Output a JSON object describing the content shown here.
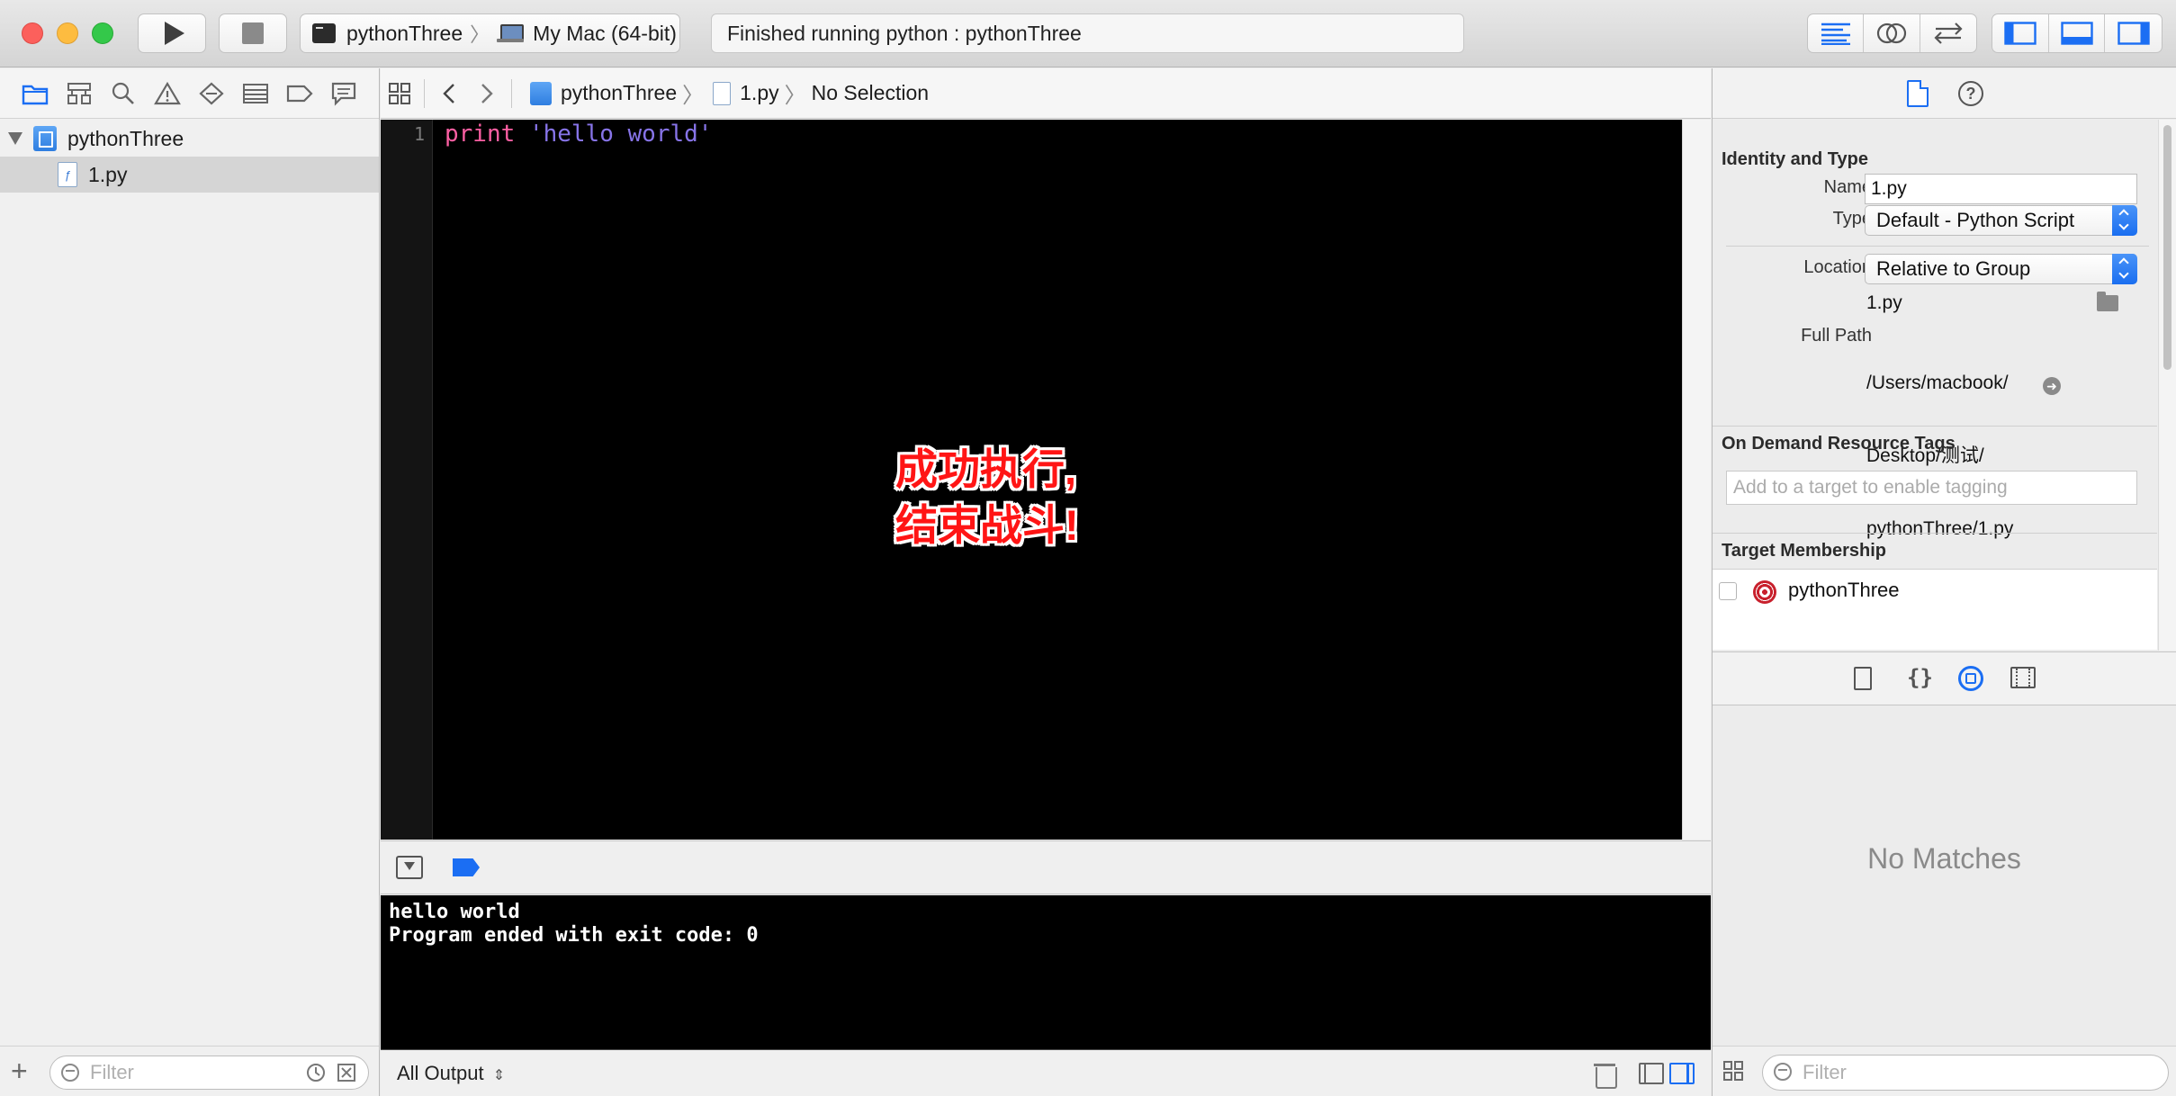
{
  "toolbar": {
    "scheme": {
      "target": "pythonThree",
      "destination": "My Mac (64-bit)"
    },
    "activity_status": "Finished running python : pythonThree"
  },
  "navigator": {
    "project_name": "pythonThree",
    "files": [
      {
        "name": "1.py",
        "selected": true
      }
    ],
    "filter_placeholder": "Filter"
  },
  "editor": {
    "jump_bar": {
      "project": "pythonThree",
      "file": "1.py",
      "selection": "No Selection"
    },
    "line_number": "1",
    "code": {
      "keyword": "print",
      "string": "'hello world'"
    },
    "overlay_line1": "成功执行,",
    "overlay_line2": "结束战斗!"
  },
  "console": {
    "line1": "hello world",
    "line2": "Program ended with exit code: 0",
    "output_filter": "All Output"
  },
  "inspector": {
    "identity_title": "Identity and Type",
    "name_label": "Name",
    "name_value": "1.py",
    "type_label": "Type",
    "type_value": "Default - Python Script",
    "location_label": "Location",
    "location_value": "Relative to Group",
    "file_name": "1.py",
    "full_path_label": "Full Path",
    "full_path_line1": "/Users/macbook/",
    "full_path_line2": "Desktop/测试/",
    "full_path_line3": "pythonThree/1.py",
    "tags_title": "On Demand Resource Tags",
    "tags_placeholder": "Add to a target to enable tagging",
    "membership_title": "Target Membership",
    "target_name": "pythonThree",
    "target_checked": false,
    "help_glyph": "?",
    "code_snippet_glyph": "{}",
    "no_matches": "No Matches",
    "filter_placeholder": "Filter"
  },
  "colors": {
    "accent": "#1b6ef3",
    "keyword": "#fc5fa3",
    "string": "#8774e8",
    "overlay_text": "#ff1515",
    "close": "#fc605c",
    "minimize": "#fdbc40",
    "zoom": "#34c84a"
  }
}
